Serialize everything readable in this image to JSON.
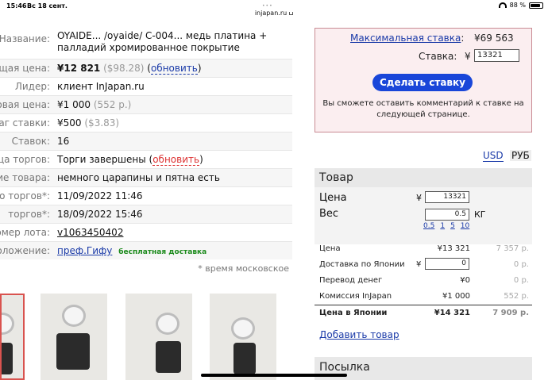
{
  "status_bar": {
    "time": "15:46",
    "date": "Вс 18 сент.",
    "url": "injapan.ru",
    "battery": "88 %",
    "battery_level": 0.88
  },
  "details": {
    "rows": [
      {
        "label": "Название:",
        "value": "OYAIDE... /oyaide/ C-004... медь платина +",
        "value2": "палладий хромированное покрытие"
      },
      {
        "label": "ущая цена:",
        "price": "¥12 821",
        "price_alt": "($98.28)",
        "link": "обновить"
      },
      {
        "label": "Лидер:",
        "value": "клиент InJapan.ru"
      },
      {
        "label": "овая цена:",
        "value": "¥1 000",
        "value_alt": "(552 р.)"
      },
      {
        "label": "аг ставки:",
        "value": "¥500",
        "value_alt": "($3.83)"
      },
      {
        "label": "Ставок:",
        "value": "16"
      },
      {
        "label": "ца торгов:",
        "value": "Торги завершены",
        "link": "обновить"
      },
      {
        "label": "ие товара:",
        "value": "немного царапины и пятна есть"
      },
      {
        "label": "о торгов*:",
        "value": "11/09/2022 11:46"
      },
      {
        "label": "торгов*:",
        "value": "18/09/2022 15:46"
      },
      {
        "label": "омер лота:",
        "value": "v1063450402"
      },
      {
        "label": "оложение:",
        "value": "преф.Гифу",
        "badge": "бесплатная доставка"
      }
    ],
    "note": "* время московское"
  },
  "bid": {
    "max_label": "Максимальная ставка",
    "max_value": "¥69 563",
    "bid_label": "Ставка:",
    "currency": "¥",
    "bid_value": "13321",
    "button": "Сделать ставку",
    "note_line1": "Вы сможете оставить комментарий к ставке на",
    "note_line2": "следующей странице."
  },
  "currency_toggle": {
    "usd": "USD",
    "rub": "РУБ"
  },
  "calc": {
    "title": "Товар",
    "price_label": "Цена",
    "price_currency": "¥",
    "price_value": "13321",
    "weight_label": "Вес",
    "weight_value": "0.5",
    "weight_unit": "КГ",
    "weight_options": [
      "0.5",
      "1",
      "5",
      "10"
    ],
    "rows": [
      {
        "name": "Цена",
        "yen": "¥13 321",
        "rub": "7 357 р."
      },
      {
        "name": "Доставка по Японии",
        "yen_prefix": "¥",
        "input": "0",
        "rub": "0 р."
      },
      {
        "name": "Перевод денег",
        "yen": "¥0",
        "rub": "0 р."
      },
      {
        "name": "Комиссия InJapan",
        "yen": "¥1 000",
        "rub": "552 р."
      }
    ],
    "total": {
      "name": "Цена в Японии",
      "yen": "¥14 321",
      "rub": "7 909 р."
    },
    "add_item": "Добавить товар",
    "parcel_title": "Посылка"
  }
}
